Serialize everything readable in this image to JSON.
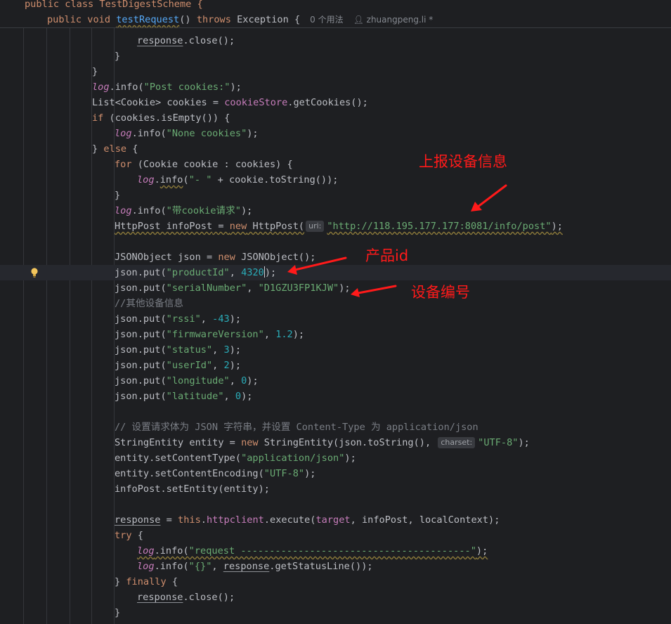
{
  "sticky": {
    "class_line": "public class TestDigestScheme {",
    "method_keywords": "public void",
    "method_name": "testRequest",
    "method_params": "()",
    "method_throws": "throws",
    "method_exception": "Exception {",
    "usages": "0 个用法",
    "author": "zhuangpeng.li *"
  },
  "code": {
    "l1_resp": "response",
    "l1_rest": ".close();",
    "brace_close": "}",
    "l4_rest": ".info(",
    "l4_str": "\"Post cookies:\"",
    "l4_end": ");",
    "l5_a": "List<Cookie> cookies = ",
    "l5_fld": "cookieStore",
    "l5_b": ".getCookies();",
    "kw_if": "if",
    "l6_rest": " (cookies.isEmpty()) {",
    "log": "log",
    "l7_str": "\"None cookies\"",
    "l8_a": "} ",
    "kw_else": "else",
    "l8_b": " {",
    "kw_for": "for",
    "l9_rest": " (Cookie cookie : cookies) {",
    "info": "info",
    "l10_str": "\"- \"",
    "l10_rest": " + cookie.toString());",
    "l12_str": "\"带cookie请求\"",
    "l13_a": "HttpPost infoPost",
    "l13_b": " = ",
    "kw_new": "new",
    "l13_c": " HttpPost(",
    "hint_uri": "uri:",
    "l13_url": "\"http://118.195.177.177:8081/info/post\"",
    "l13_end": ");",
    "l15_a": "JSONObject json = ",
    "l15_b": " JSONObject();",
    "put": "json.put(",
    "l16_key": "\"productId\"",
    "l16_num": "4320",
    "l16_end": ");",
    "l17_key": "\"serialNumber\"",
    "l17_val": "\"D1GZU3FP1KJW\"",
    "l18_cmt": "//其他设备信息",
    "k_rssi": "\"rssi\"",
    "v_rssi": "-43",
    "k_fw": "\"firmwareVersion\"",
    "v_fw": "1.2",
    "k_status": "\"status\"",
    "v_status": "3",
    "k_user": "\"userId\"",
    "v_user": "2",
    "k_lng": "\"longitude\"",
    "v_lng": "0",
    "k_lat": "\"latitude\"",
    "v_lat": "0",
    "sep": ", ",
    "l27_cmt": "// 设置请求体为 JSON 字符串，并设置 Content-Type 为 application/json",
    "l28_a": "StringEntity entity = ",
    "l28_b": " StringEntity(json.toString(), ",
    "hint_charset": "charset:",
    "utf8": "\"UTF-8\"",
    "l29_a": "entity.setContentType(",
    "l29_str": "\"application/json\"",
    "l30_a": "entity.setContentEncoding(",
    "l31": "infoPost.setEntity(entity);",
    "l33_b": " = ",
    "kw_this": "this",
    "l33_fld1": "httpclient",
    "l33_c": ".execute(",
    "l33_fld2": "target",
    "l33_d": ", infoPost, localContext);",
    "kw_try": "try",
    "l34_b": " {",
    "l35_str": "\"request ----------------------------------------\"",
    "l36_str": "\"{}\"",
    "l36_c": ".getStatusLine());",
    "l37_a": "} ",
    "kw_finally": "finally",
    "l37_b": " {"
  },
  "annotations": {
    "upload": "上报设备信息",
    "product": "产品id",
    "serial": "设备编号"
  },
  "colors": {
    "background": "#1e1f22",
    "keyword": "#cf8e6d",
    "string": "#6aab73",
    "number": "#2aacb8",
    "field": "#c77dbb",
    "comment": "#7a7e85",
    "annotation": "#ff1a1a"
  },
  "icons": {
    "gutter": "lightbulb-icon"
  }
}
